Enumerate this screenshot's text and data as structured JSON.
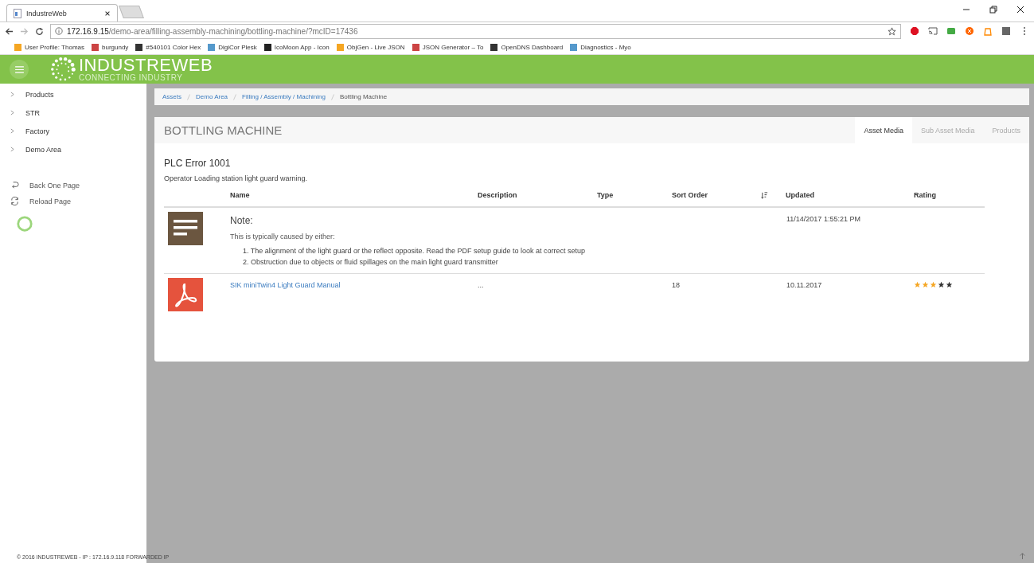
{
  "browser": {
    "tab_title": "IndustreWeb",
    "url_host": "172.16.9.15",
    "url_path": "/demo-area/filling-assembly-machining/bottling-machine/?mcID=17436",
    "bookmarks": [
      "User Profile: Thomas",
      "burgundy",
      "#540101 Color Hex",
      "DigiCor Plesk",
      "IcoMoon App - Icon",
      "ObjGen - Live JSON",
      "JSON Generator – To",
      "OpenDNS Dashboard",
      "Diagnostics - Myo"
    ]
  },
  "header": {
    "logo": "INDUSTREWEB",
    "tagline": "CONNECTING INDUSTRY"
  },
  "sidebar": {
    "items": [
      {
        "label": "Products",
        "expanded": false
      },
      {
        "label": "STR",
        "expanded": false
      },
      {
        "label": "Factory",
        "expanded": false
      },
      {
        "label": "Demo Area",
        "expanded": false
      }
    ],
    "actions": [
      {
        "kind": "back",
        "label": "Back One Page"
      },
      {
        "kind": "reload",
        "label": "Reload Page"
      }
    ]
  },
  "breadcrumb": [
    "Assets",
    "Demo Area",
    "Filling / Assembly / Machining",
    "Bottling Machine"
  ],
  "panel": {
    "title": "BOTTLING MACHINE",
    "tabs": [
      {
        "label": "Asset Media",
        "selected": true
      },
      {
        "label": "Sub Asset Media",
        "selected": false
      },
      {
        "label": "Products",
        "selected": false
      }
    ],
    "error_title": "PLC Error 1001",
    "error_text": "Operator Loading station light guard warning.",
    "table": {
      "columns": [
        "Name",
        "Description",
        "Type",
        "Sort Order",
        "Updated",
        "Rating"
      ],
      "rows": [
        {
          "kind": "note",
          "title": "Note:",
          "intro": "This is typically caused by either:",
          "steps": [
            "1. The alignment of the light guard or the reflect opposite. Read the PDF setup guide to look at correct setup",
            "2. Obstruction due to objects or fluid spillages on the main light guard transmitter"
          ],
          "updated": "11/14/2017 1:55:21 PM"
        },
        {
          "kind": "pdf",
          "name": "SIK miniTwin4 Light Guard Manual",
          "description": "...",
          "sort_order": "18",
          "updated": "10.11.2017",
          "stars": 3
        }
      ]
    }
  },
  "footer": "© 2016 INDUSTREWEB - IP : 172.16.9.118 FORWARDED IP"
}
